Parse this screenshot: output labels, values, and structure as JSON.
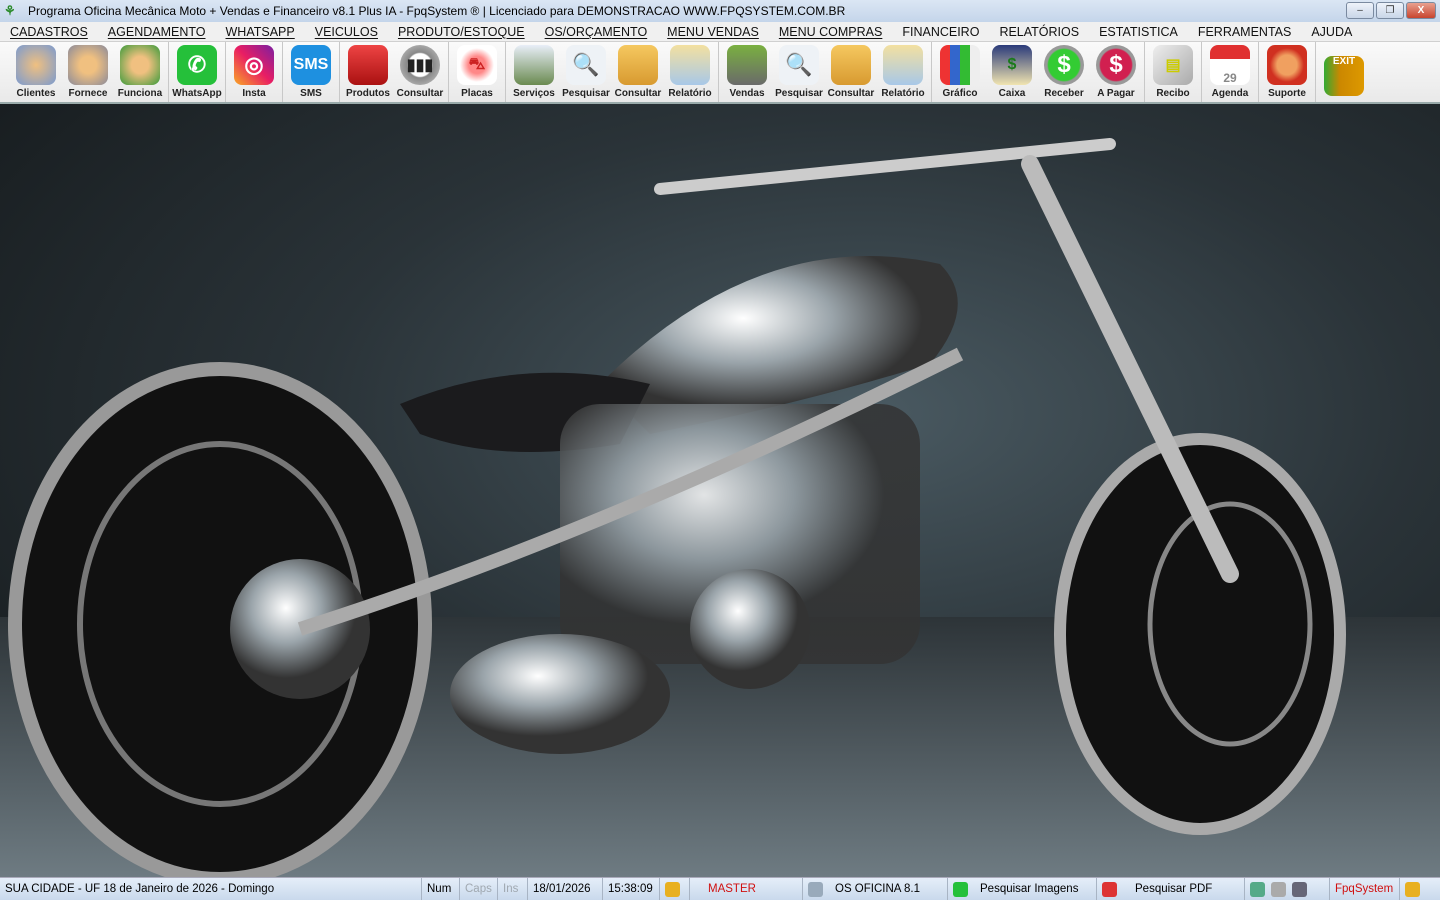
{
  "window": {
    "title": "Programa Oficina Mecânica Moto + Vendas e Financeiro v8.1 Plus IA - FpqSystem ® | Licenciado para  DEMONSTRACAO WWW.FPQSYSTEM.COM.BR",
    "minimize": "–",
    "restore": "❐",
    "close": "X"
  },
  "menu": [
    "CADASTROS",
    "AGENDAMENTO",
    "WHATSAPP",
    "VEICULOS",
    "PRODUTO/ESTOQUE",
    "OS/ORÇAMENTO",
    "MENU VENDAS",
    "MENU COMPRAS",
    "FINANCEIRO",
    "RELATÓRIOS",
    "ESTATISTICA",
    "FERRAMENTAS",
    "AJUDA"
  ],
  "toolbar": {
    "clientes": "Clientes",
    "fornece": "Fornece",
    "funciona": "Funciona",
    "whatsapp": "WhatsApp",
    "insta": "Insta",
    "sms": "SMS",
    "sms_icon": "SMS",
    "produtos": "Produtos",
    "consultar_prod": "Consultar",
    "placas": "Placas",
    "servicos": "Serviços",
    "pesquisar_os": "Pesquisar",
    "consultar_os": "Consultar",
    "relatorio_os": "Relatório",
    "vendas": "Vendas",
    "pesquisar_v": "Pesquisar",
    "consultar_v": "Consultar",
    "relatorio_v": "Relatório",
    "grafico": "Gráfico",
    "caixa": "Caixa",
    "receber": "Receber",
    "apagar": "A Pagar",
    "recibo": "Recibo",
    "agenda": "Agenda",
    "agenda_icon": "29",
    "suporte": "Suporte",
    "exit_icon": "EXIT"
  },
  "status": {
    "city": "SUA CIDADE - UF 18 de Janeiro de 2026 - Domingo",
    "num": "Num",
    "caps": "Caps",
    "ins": "Ins",
    "date": "18/01/2026",
    "time": "15:38:09",
    "user": "MASTER",
    "system": "OS OFICINA 8.1",
    "images": "Pesquisar Imagens",
    "pdf": "Pesquisar PDF",
    "brand": "FpqSystem"
  }
}
